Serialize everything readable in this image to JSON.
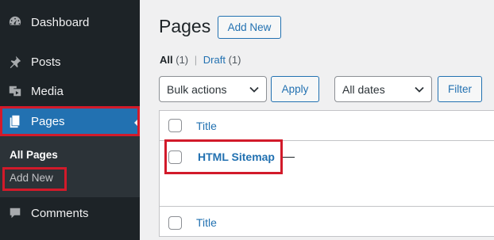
{
  "sidebar": {
    "items": [
      {
        "label": "Dashboard",
        "icon": "dashboard-icon"
      },
      {
        "label": "Posts",
        "icon": "pin-icon"
      },
      {
        "label": "Media",
        "icon": "media-icon"
      },
      {
        "label": "Pages",
        "icon": "pages-icon"
      },
      {
        "label": "Comments",
        "icon": "comments-icon"
      }
    ],
    "submenu": {
      "all_pages": "All Pages",
      "add_new": "Add New"
    }
  },
  "main": {
    "title": "Pages",
    "add_new_label": "Add New",
    "views": [
      {
        "label": "All",
        "count": "(1)"
      },
      {
        "label": "Draft",
        "count": "(1)"
      }
    ],
    "bulk_actions": "Bulk actions",
    "apply_label": "Apply",
    "all_dates": "All dates",
    "filter_label": "Filter",
    "table": {
      "header_title": "Title",
      "footer_title": "Title",
      "rows": [
        {
          "title": "HTML Sitemap"
        }
      ]
    }
  },
  "colors": {
    "sidebar_bg": "#1d2327",
    "active_bg": "#2271b1",
    "highlight": "#d21a2a",
    "link": "#2271b1"
  }
}
